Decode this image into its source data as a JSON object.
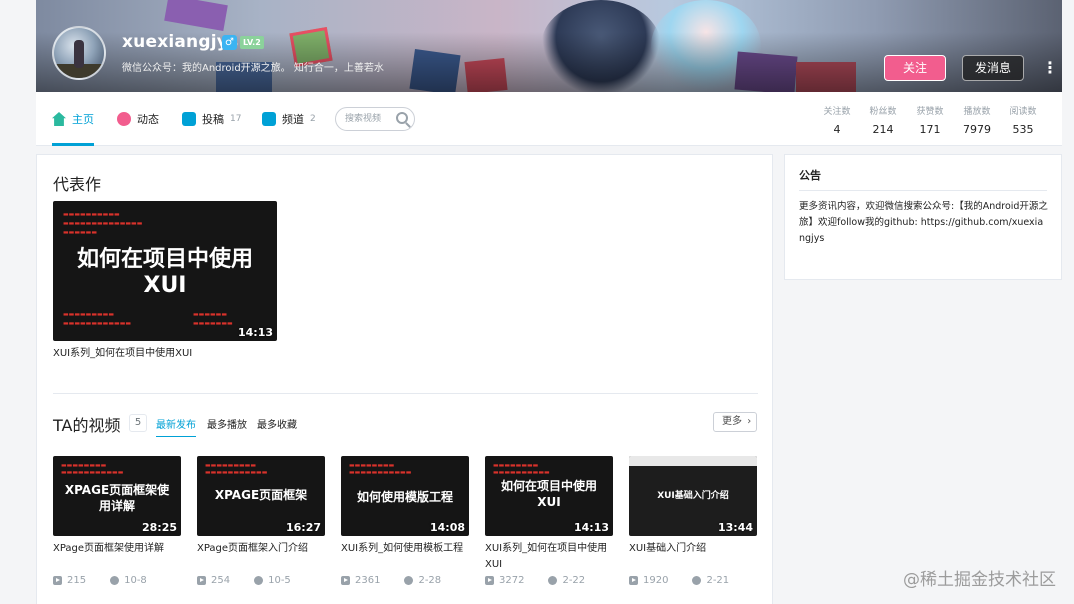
{
  "header": {
    "username": "xuexiangjys",
    "gender_icon": "♂",
    "level_badge": "LV.2",
    "sign": "微信公众号：我的Android开源之旅。 知行合一，上善若水",
    "follow_label": "关注",
    "message_label": "发消息",
    "more_glyph": "⋮",
    "accent_color": "#f25d8e"
  },
  "nav": {
    "tabs": [
      {
        "label": "主页",
        "count": "",
        "icon": "home-icon",
        "color": "#2bb99f"
      },
      {
        "label": "动态",
        "count": "",
        "icon": "feed-icon",
        "color": "#f25d8e"
      },
      {
        "label": "投稿",
        "count": "17",
        "icon": "upload-icon",
        "color": "#00a1d6"
      },
      {
        "label": "频道",
        "count": "2",
        "icon": "channel-icon",
        "color": "#00a1d6"
      }
    ],
    "search_placeholder": "搜索视频",
    "stats": [
      {
        "label": "关注数",
        "value": "4"
      },
      {
        "label": "粉丝数",
        "value": "214"
      },
      {
        "label": "获赞数",
        "value": "171"
      },
      {
        "label": "播放数",
        "value": "7979"
      },
      {
        "label": "阅读数",
        "value": "535"
      }
    ]
  },
  "masterpiece": {
    "title": "代表作",
    "video": {
      "cover_text": "如何在项目中使用",
      "cover_text2": "XUI",
      "duration": "14:13",
      "title": "XUI系列_如何在项目中使用XUI"
    }
  },
  "videos": {
    "title": "TA的视频",
    "count": "5",
    "tabs": [
      "最新发布",
      "最多播放",
      "最多收藏"
    ],
    "more_label": "更多",
    "items": [
      {
        "cover_text": "XPAGE页面框架使用详解",
        "duration": "28:25",
        "title": "XPage页面框架使用详解",
        "plays": "215",
        "date": "10-8"
      },
      {
        "cover_text": "XPAGE页面框架",
        "duration": "16:27",
        "title": "XPage页面框架入门介绍",
        "plays": "254",
        "date": "10-5"
      },
      {
        "cover_text": "如何使用模版工程",
        "duration": "14:08",
        "title": "XUI系列_如何使用模板工程",
        "plays": "2361",
        "date": "2-28"
      },
      {
        "cover_text": "如何在项目中使用XUI",
        "duration": "14:13",
        "title": "XUI系列_如何在项目中使用XUI",
        "plays": "3272",
        "date": "2-22"
      },
      {
        "cover_text": "XUI基础入门介绍",
        "duration": "13:44",
        "title": "XUI基础入门介绍",
        "plays": "1920",
        "date": "2-21"
      }
    ]
  },
  "notice": {
    "title": "公告",
    "body": "更多资讯内容，欢迎微信搜索公众号:【我的Android开源之旅】欢迎follow我的github: https://github.com/xuexiangjys"
  },
  "watermark": "@稀土掘金技术社区"
}
